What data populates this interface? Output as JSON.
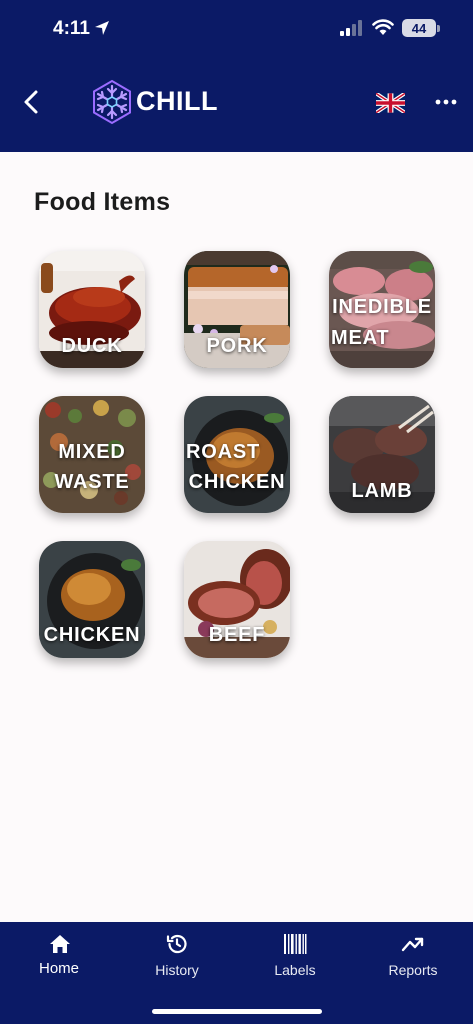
{
  "status_bar": {
    "time": "4:11",
    "battery": "44"
  },
  "header": {
    "app_name": "CHILL",
    "language": "UK flag"
  },
  "page": {
    "title": "Food Items"
  },
  "food_items": [
    {
      "label_lines": [
        "DUCK"
      ]
    },
    {
      "label_lines": [
        "PORK"
      ]
    },
    {
      "label_lines": [
        "INEDIBLE",
        "MEAT"
      ]
    },
    {
      "label_lines": [
        "MIXED",
        "WASTE"
      ]
    },
    {
      "label_lines": [
        "ROAST",
        "CHICKEN"
      ]
    },
    {
      "label_lines": [
        "LAMB"
      ]
    },
    {
      "label_lines": [
        "CHICKEN"
      ]
    },
    {
      "label_lines": [
        "BEEF"
      ]
    }
  ],
  "bottom_nav": {
    "items": [
      {
        "label": "Home",
        "icon": "home-icon",
        "active": true
      },
      {
        "label": "History",
        "icon": "history-icon",
        "active": false
      },
      {
        "label": "Labels",
        "icon": "barcode-icon",
        "active": false
      },
      {
        "label": "Reports",
        "icon": "trend-icon",
        "active": false
      }
    ]
  },
  "colors": {
    "brand_navy": "#0b1a66",
    "background": "#fdfafb",
    "logo_accent": "#9b6cff"
  }
}
